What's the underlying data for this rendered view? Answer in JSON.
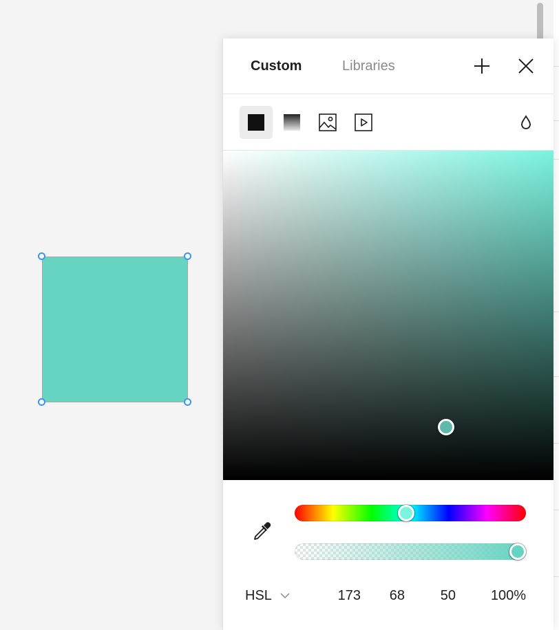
{
  "canvas": {
    "shape_fill": "#67d3c1",
    "selection_color": "#3a95f2"
  },
  "picker": {
    "tabs": [
      {
        "label": "Custom",
        "active": true
      },
      {
        "label": "Libraries",
        "active": false
      }
    ],
    "header_icons": [
      "plus-icon",
      "close-icon"
    ],
    "fill_types": [
      {
        "icon": "solid-fill-icon",
        "active": true
      },
      {
        "icon": "gradient-fill-icon",
        "active": false
      },
      {
        "icon": "image-fill-icon",
        "active": false
      },
      {
        "icon": "video-fill-icon",
        "active": false
      }
    ],
    "blend_icon": "blend-mode-drop-icon",
    "hue_color": "#7af3df",
    "color_model": "HSL",
    "values": {
      "h": "173",
      "s": "68",
      "l": "50",
      "alpha": "100%"
    }
  }
}
